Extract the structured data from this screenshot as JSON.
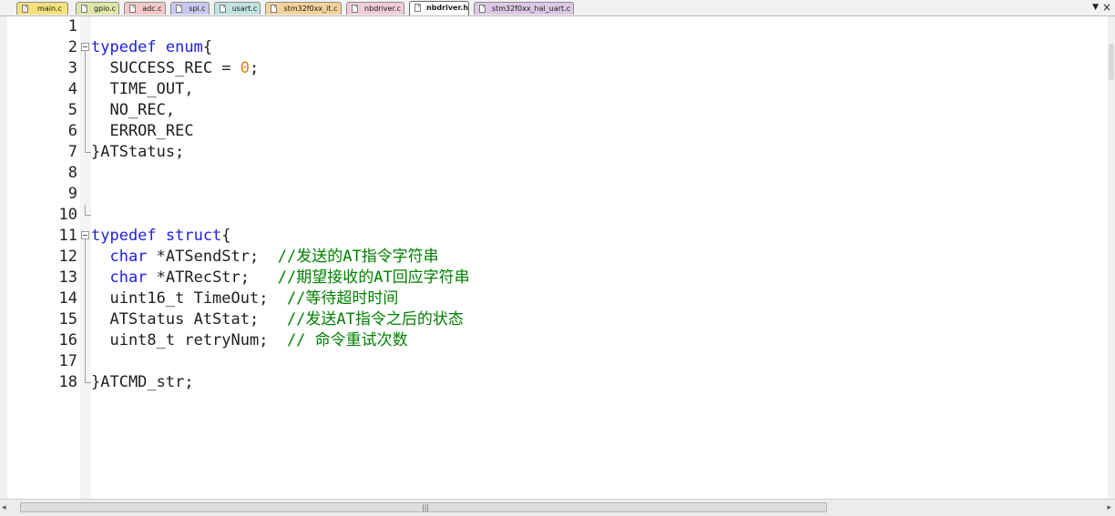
{
  "tabs": [
    {
      "label": "main.c",
      "color": "#f5e27a"
    },
    {
      "label": "gpio.c",
      "color": "#dfe6a8"
    },
    {
      "label": "adc.c",
      "color": "#f2c8c8"
    },
    {
      "label": "spi.c",
      "color": "#c8c8f0"
    },
    {
      "label": "usart.c",
      "color": "#bfe4e0"
    },
    {
      "label": "stm32f0xx_it.c",
      "color": "#f4d39a"
    },
    {
      "label": "nbdriver.c",
      "color": "#f0cdd8"
    },
    {
      "label": "nbdriver.h",
      "color": "#ffffff",
      "active": true
    },
    {
      "label": "stm32f0xx_hal_uart.c",
      "color": "#dcc8e4"
    }
  ],
  "tab_controls": {
    "dropdown": "▼",
    "close": "×"
  },
  "code": {
    "line_numbers": [
      "1",
      "2",
      "3",
      "4",
      "5",
      "6",
      "7",
      "8",
      "9",
      "10",
      "11",
      "12",
      "13",
      "14",
      "15",
      "16",
      "17",
      "18"
    ],
    "l2_kw": "typedef enum",
    "l2_rest": "{",
    "l3_a": "  SUCCESS_REC = ",
    "l3_num": "0",
    "l3_b": ";",
    "l4": "  TIME_OUT,",
    "l5": "  NO_REC,",
    "l6": "  ERROR_REC",
    "l7": "}ATStatus;",
    "l11_kw": "typedef struct",
    "l11_rest": "{",
    "l12_kw": "  char",
    "l12_code": " *ATSendStr;  ",
    "l12_cm_a": "//发送的",
    "l12_cm_b": "AT",
    "l12_cm_c": "指令字符串",
    "l13_kw": "  char",
    "l13_code": " *ATRecStr;   ",
    "l13_cm_a": "//期望接收的",
    "l13_cm_b": "AT",
    "l13_cm_c": "回应字符串",
    "l14_code": "  uint16_t TimeOut;  ",
    "l14_cm": "//等待超时时间",
    "l15_code": "  ATStatus AtStat;   ",
    "l15_cm_a": "//发送",
    "l15_cm_b": "AT",
    "l15_cm_c": "指令之后的状态",
    "l16_code": "  uint8_t retryNum;  ",
    "l16_cm": "// 命令重试次数",
    "l18": "}ATCMD_str;"
  },
  "scrollbar": {
    "left_arrow": "◂",
    "right_arrow": "▸",
    "grip": "|||"
  },
  "colors": {
    "keyword": "#2020e0",
    "number": "#e08000",
    "comment": "#008000"
  }
}
